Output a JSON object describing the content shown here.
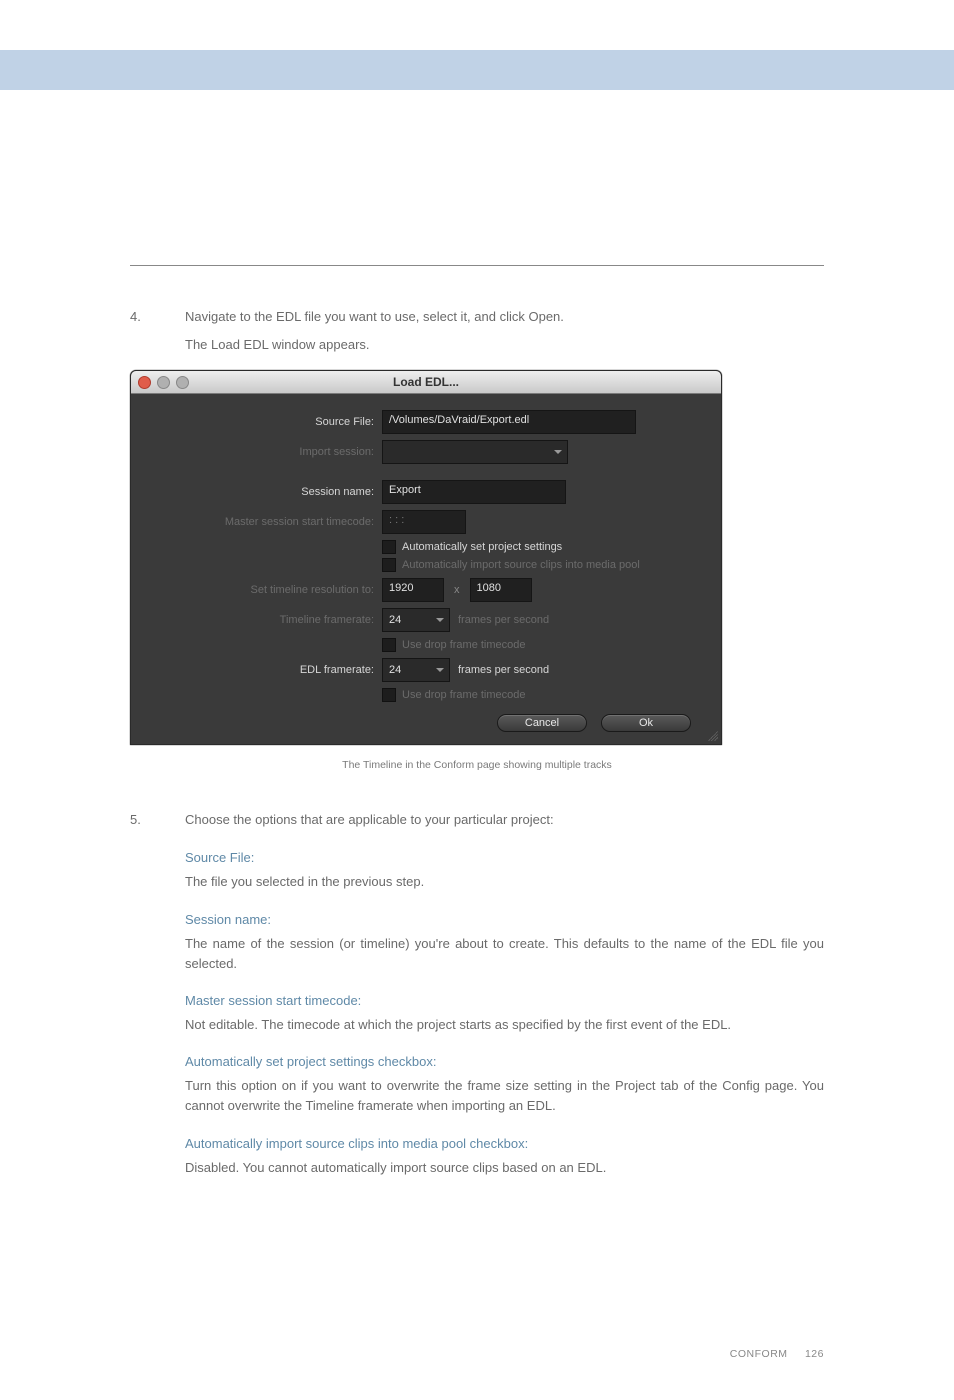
{
  "step4": {
    "num": "4.",
    "text": "Navigate to the EDL file you want to use, select it, and click Open.",
    "sub": "The Load EDL window appears."
  },
  "dialog": {
    "title": "Load EDL...",
    "labels": {
      "sourceFile": "Source File:",
      "importSession": "Import session:",
      "sessionName": "Session name:",
      "masterTC": "Master session start timecode:",
      "setRes": "Set timeline resolution to:",
      "tlFramerate": "Timeline framerate:",
      "edlFramerate": "EDL framerate:"
    },
    "values": {
      "sourceFile": "/Volumes/DaVraid/Export.edl",
      "importSession": "",
      "sessionName": "Export",
      "masterTC": ":  :  :",
      "resW": "1920",
      "resH": "1080",
      "tlFps": "24",
      "edlFps": "24"
    },
    "checks": {
      "autoSettings": "Automatically set project settings",
      "autoImport": "Automatically import source clips into media pool",
      "dropTl": "Use drop frame timecode",
      "dropEdl": "Use drop frame timecode"
    },
    "fpsLabel": "frames per second",
    "x": "x",
    "buttons": {
      "cancel": "Cancel",
      "ok": "Ok"
    }
  },
  "caption": "The Timeline in the Conform page showing multiple tracks",
  "step5": {
    "num": "5.",
    "text": "Choose the options that are applicable to your particular project:"
  },
  "options": {
    "sourceFile": {
      "title": "Source File:",
      "desc": "The file you selected in the previous step."
    },
    "sessionName": {
      "title": "Session name:",
      "desc": "The name of the session (or timeline) you're about to create. This defaults to the name of the EDL file you selected."
    },
    "masterTC": {
      "title": "Master session start timecode:",
      "desc": "Not editable. The timecode at which the project starts as specified by the first event of the EDL."
    },
    "autoSettings": {
      "title": "Automatically set project settings checkbox:",
      "desc": "Turn this option on if you want to overwrite the frame size setting in the Project tab of the Config page. You cannot overwrite the Timeline framerate when importing an EDL."
    },
    "autoImport": {
      "title": "Automatically import source clips into media pool checkbox:",
      "desc": "Disabled. You cannot automatically import source clips based on an EDL."
    }
  },
  "footer": {
    "section": "CONFORM",
    "page": "126"
  }
}
